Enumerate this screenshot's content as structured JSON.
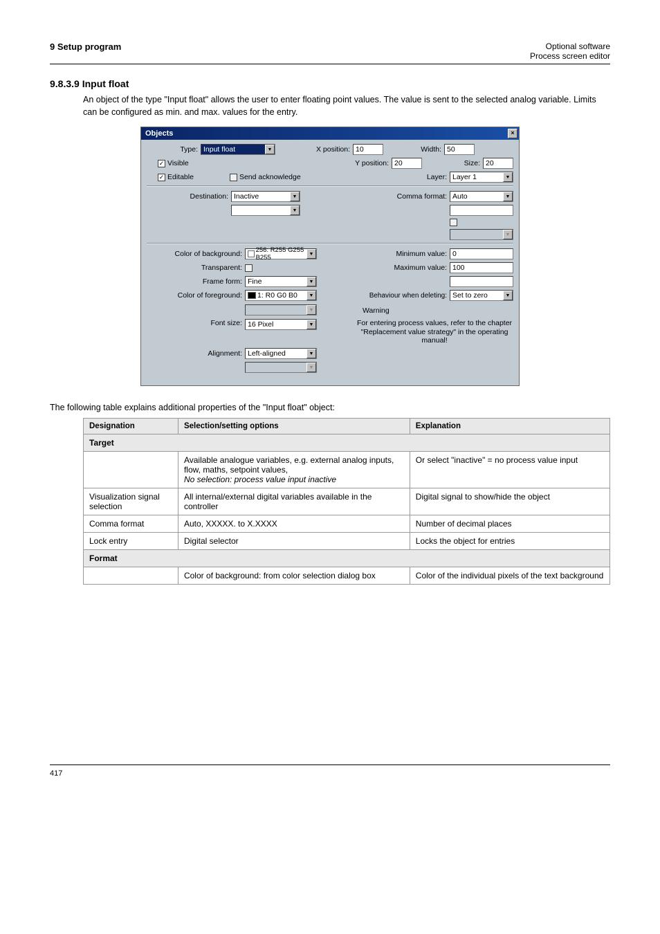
{
  "header": {
    "left": "9 Setup program",
    "right_top": "Optional software",
    "right_bottom": "Process screen editor"
  },
  "pre": {
    "heading": "9.8.3.9 Input float",
    "text": "An object of the type \"Input float\" allows the user to enter floating point values. The value is sent to the selected analog variable. Limits can be configured as min. and max. values for the entry."
  },
  "dialog": {
    "title": "Objects",
    "type_label": "Type:",
    "type_value": "Input float",
    "xpos_label": "X position:",
    "xpos_value": "10",
    "width_label": "Width:",
    "width_value": "50",
    "visible_label": "Visible",
    "visible_checked": true,
    "ypos_label": "Y position:",
    "ypos_value": "20",
    "size_label": "Size:",
    "size_value": "20",
    "editable_label": "Editable",
    "editable_checked": true,
    "sendack_label": "Send acknowledge",
    "sendack_checked": false,
    "layer_label": "Layer:",
    "layer_value": "Layer 1",
    "destination_label": "Destination:",
    "destination_value": "Inactive",
    "comma_label": "Comma format:",
    "comma_value": "Auto",
    "colorbg_label": "Color of background:",
    "colorbg_value": "256: R255 G255 B255",
    "min_label": "Minimum value:",
    "min_value": "0",
    "transparent_label": "Transparent:",
    "max_label": "Maximum value:",
    "max_value": "100",
    "frame_label": "Frame form:",
    "frame_value": "Fine",
    "colorfg_label": "Color of foreground:",
    "colorfg_value": "1: R0 G0 B0",
    "behavior_label": "Behaviour when deleting:",
    "behavior_value": "Set to zero",
    "fontsize_label": "Font size:",
    "fontsize_value": "16 Pixel",
    "align_label": "Alignment:",
    "align_value": "Left-aligned",
    "warning_label": "Warning",
    "warning_text": "For entering process values, refer to the chapter \"Replacement value strategy\" in the operating manual!"
  },
  "intro": "The following table explains additional properties of the \"Input float\" object:",
  "table": {
    "h1": "Designation",
    "h2": "Selection/setting options",
    "h3": "Explanation",
    "rows": [
      {
        "section": "Target",
        "cells": [
          {
            "d": "",
            "s": "Available analogue variables, e.g. external analog inputs, flow, maths, setpoint values,\nNo selection: process value input inactive",
            "e": "Or select \"inactive\" = no process value input"
          }
        ]
      },
      {
        "d": "Visualization signal selection",
        "s": "All internal/external digital variables available in the controller",
        "e": "Digital signal to show/hide the object"
      },
      {
        "d": "Comma format",
        "s": "Auto, XXXXX. to X.XXXX",
        "e": "Number of decimal places"
      },
      {
        "d": "Lock entry",
        "s": "Digital selector",
        "e": "Locks the object for entries"
      },
      {
        "section": "Format",
        "cells": [
          {
            "d": "",
            "s": "Color of background: from color selection dialog box",
            "e": "Color of the individual pixels of the text background"
          }
        ]
      }
    ]
  },
  "footer": {
    "left": "417",
    "right": ""
  }
}
